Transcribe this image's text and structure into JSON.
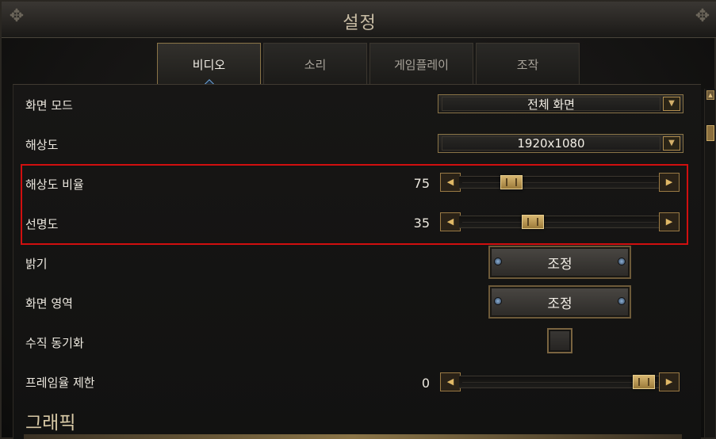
{
  "window": {
    "title": "설정"
  },
  "tabs": [
    {
      "label": "비디오",
      "active": true
    },
    {
      "label": "소리",
      "active": false
    },
    {
      "label": "게임플레이",
      "active": false
    },
    {
      "label": "조작",
      "active": false
    }
  ],
  "settings": {
    "screen_mode": {
      "label": "화면 모드",
      "value": "전체 화면"
    },
    "resolution": {
      "label": "해상도",
      "value": "1920x1080"
    },
    "resolution_scale": {
      "label": "해상도 비율",
      "value": "75",
      "level": 0.23
    },
    "sharpness": {
      "label": "선명도",
      "value": "35",
      "level": 0.35
    },
    "brightness": {
      "label": "밝기",
      "button": "조정"
    },
    "screen_area": {
      "label": "화면 영역",
      "button": "조정"
    },
    "vsync": {
      "label": "수직 동기화",
      "checked": false
    },
    "frame_limit": {
      "label": "프레임율 제한",
      "value": "0",
      "level": 0.97
    }
  },
  "section": {
    "graphics": "그래픽"
  },
  "colors": {
    "accent": "#8a7447",
    "highlight": "#d10f0f",
    "text": "#ece8df"
  },
  "icons": {
    "dropdown": "chevron-down-icon",
    "slider_left": "arrow-left-icon",
    "slider_right": "arrow-right-icon",
    "corner": "ornament-icon"
  }
}
